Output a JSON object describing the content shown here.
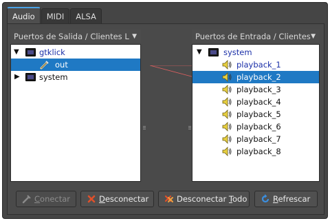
{
  "tabs": [
    {
      "label": "Audio",
      "active": true
    },
    {
      "label": "MIDI",
      "active": false
    },
    {
      "label": "ALSA",
      "active": false
    }
  ],
  "left_list": {
    "header": "Puertos de Salida / Clientes L",
    "items": [
      {
        "label": "gtklick",
        "type": "client",
        "expanded": true
      },
      {
        "label": "out",
        "type": "port",
        "selected": true
      },
      {
        "label": "system",
        "type": "client",
        "expanded": false
      }
    ]
  },
  "right_list": {
    "header": "Puertos de Entrada / Clientes",
    "client": "system",
    "ports": [
      {
        "label": "playback_1",
        "connected": true,
        "selected": false
      },
      {
        "label": "playback_2",
        "connected": true,
        "selected": true
      },
      {
        "label": "playback_3",
        "connected": false,
        "selected": false
      },
      {
        "label": "playback_4",
        "connected": false,
        "selected": false
      },
      {
        "label": "playback_5",
        "connected": false,
        "selected": false
      },
      {
        "label": "playback_6",
        "connected": false,
        "selected": false
      },
      {
        "label": "playback_7",
        "connected": false,
        "selected": false
      },
      {
        "label": "playback_8",
        "connected": false,
        "selected": false
      }
    ]
  },
  "buttons": {
    "connect": {
      "label": "Conectar",
      "mnemonic": "C",
      "enabled": false
    },
    "disconnect": {
      "label": "Desconectar",
      "mnemonic": "D",
      "enabled": true
    },
    "disconnect_all": {
      "pre": "Desconectar ",
      "mnemonic": "T",
      "post": "odo",
      "enabled": true
    },
    "refresh": {
      "label": "Refrescar",
      "mnemonic": "R",
      "enabled": true
    }
  },
  "colors": {
    "accent": "#4aa3e8",
    "selection": "#1f79c4",
    "connection_line": "#e06060",
    "connected_text": "#1a2fa8"
  },
  "icons": {
    "client": "audio-client-icon",
    "port_out": "plug-icon",
    "port_in": "speaker-icon",
    "connect": "plug-connect-icon",
    "disconnect": "disconnect-x-icon",
    "disconnect_all": "disconnect-all-icon",
    "refresh": "refresh-icon"
  }
}
